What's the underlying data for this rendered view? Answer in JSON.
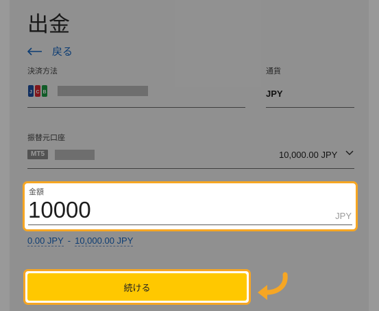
{
  "page": {
    "title": "出金",
    "back_label": "戻る"
  },
  "payment": {
    "method_label": "決済方法",
    "method_icon": "jcb-icon",
    "currency_label": "通貨",
    "currency_value": "JPY"
  },
  "account": {
    "label": "振替元口座",
    "badge": "MT5",
    "balance": "10,000.00 JPY"
  },
  "amount": {
    "label": "金額",
    "value": "10000",
    "currency": "JPY"
  },
  "range": {
    "min": "0.00 JPY",
    "separator": "-",
    "max": "10,000.00 JPY"
  },
  "actions": {
    "continue_label": "続ける"
  },
  "colors": {
    "accent": "#f6a623",
    "button": "#ffc800",
    "link": "#1565c0"
  }
}
